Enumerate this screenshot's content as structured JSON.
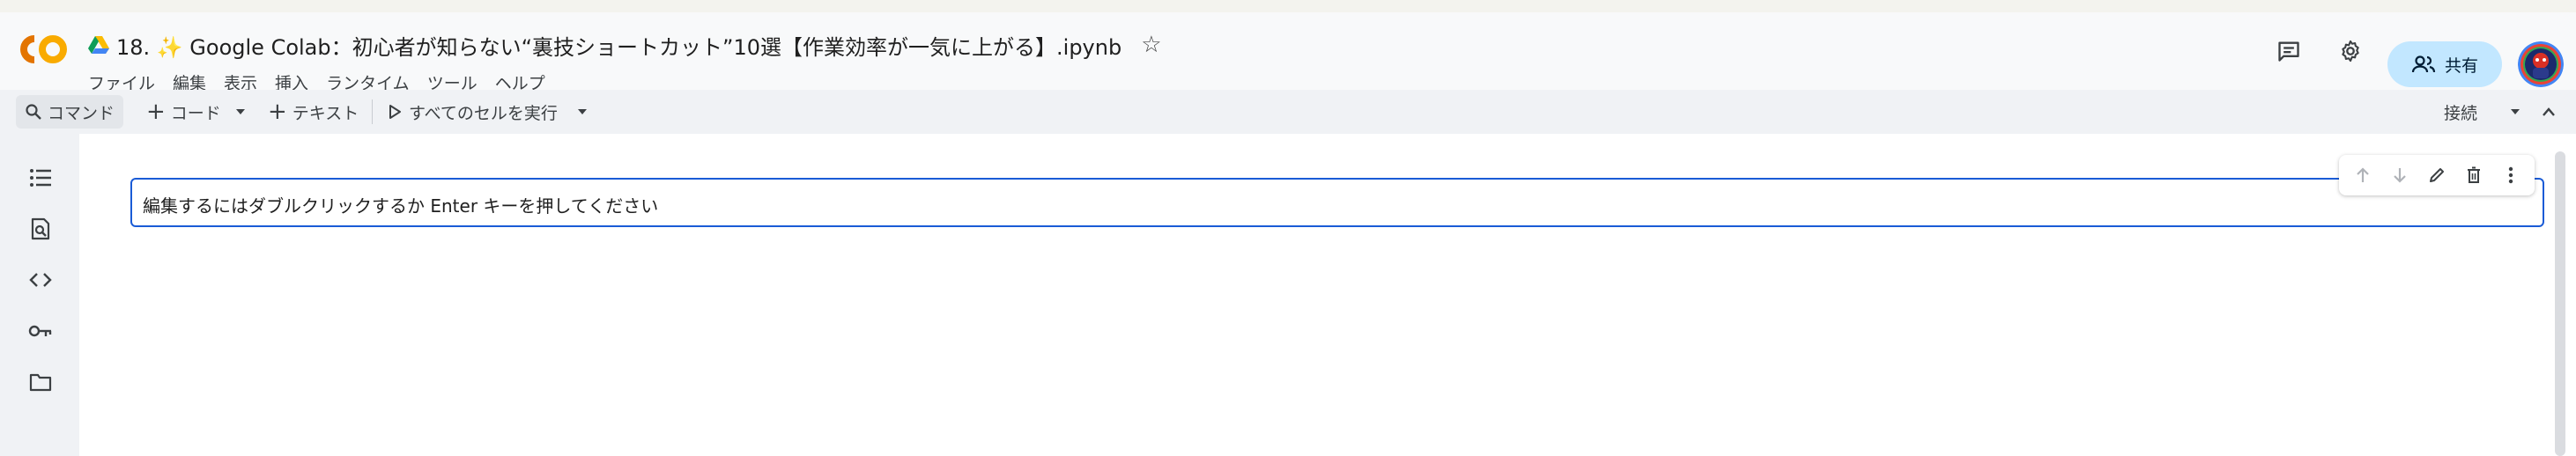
{
  "notebook": {
    "title": "18. ✨ Google Colab：初心者が知らない“裏技ショートカット”10選【作業効率が一気に上がる】.ipynb"
  },
  "menu": [
    "ファイル",
    "編集",
    "表示",
    "挿入",
    "ランタイム",
    "ツール",
    "ヘルプ"
  ],
  "header_actions": {
    "share_label": "共有"
  },
  "toolbar": {
    "command_label": "コマンド",
    "add_code_label": "コード",
    "add_text_label": "テキスト",
    "run_all_label": "すべてのセルを実行",
    "connect_label": "接続"
  },
  "cell": {
    "placeholder_text": "編集するにはダブルクリックするか Enter キーを押してください"
  },
  "icons": {
    "logo": "colab-logo",
    "drive": "google-drive-icon",
    "star": "star-icon",
    "comments": "comment-icon",
    "settings": "gear-icon",
    "share": "people-icon",
    "sidebar": [
      "table-of-contents-icon",
      "find-replace-icon",
      "code-snippets-icon",
      "secrets-key-icon",
      "files-folder-icon"
    ],
    "cell_toolbar": [
      "arrow-up-icon",
      "arrow-down-icon",
      "pencil-icon",
      "trash-icon",
      "more-vert-icon"
    ]
  },
  "colors": {
    "logo_orange": "#f9ab00",
    "logo_dark_orange": "#e37400",
    "share_bg": "#c2e7ff",
    "cell_border": "#1a5bd6"
  }
}
